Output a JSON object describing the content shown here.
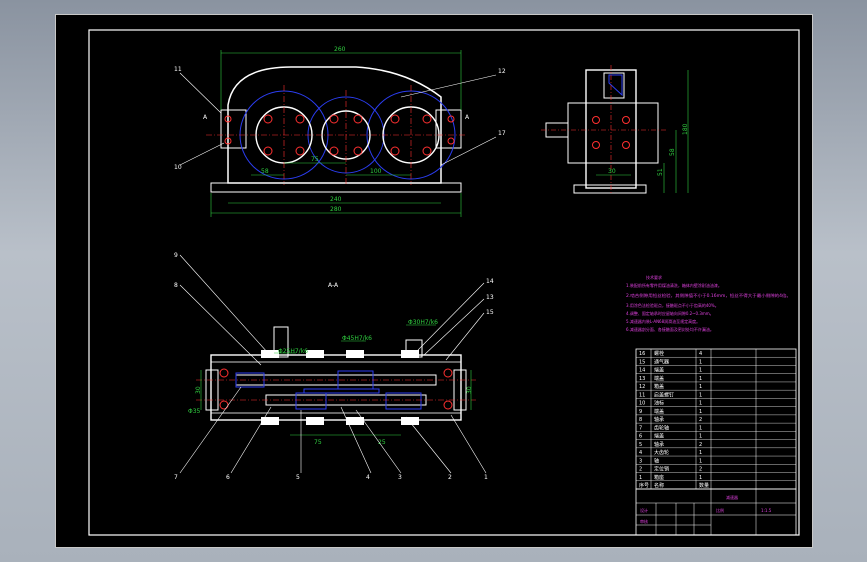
{
  "drawing": {
    "view_title": "A-A",
    "section_marks": [
      "A",
      "A"
    ],
    "front_dims": {
      "overall_top": "260",
      "overall_bottom_1": "240",
      "overall_bottom_2": "280",
      "center_1": "58",
      "center_2": "75",
      "center_3": "100"
    },
    "side_dims": {
      "d1": "58",
      "d2": "51",
      "d3": "180",
      "d4": "30"
    },
    "section_dims": {
      "bore_1": "Φ25H7/k6",
      "bore_2": "Φ45H7/k6",
      "bore_3": "Φ30H7/k6",
      "len_1": "75",
      "len_2": "25",
      "h_left": "30",
      "h_right": "30",
      "d_left": "Φ35"
    },
    "callouts_front": [
      "11",
      "10",
      "12",
      "17"
    ],
    "callouts_section": [
      "9",
      "8",
      "7",
      "6",
      "5",
      "4",
      "3",
      "2",
      "1",
      "14",
      "13",
      "15"
    ]
  },
  "tech_req": {
    "title": "技术要求",
    "lines": [
      "1.装配前所有零件用煤油清洗，箱体内壁涂耐油油漆。",
      "2.啮合侧隙用铅丝检验，其侧隙值不小于0.16mm，铅丝不得大于最小侧隙的4倍。",
      "3.用涂色法检验斑点，接触斑点不小于齿高的40%。",
      "4.调整、固定轴承时应留轴向间隙0.2~0.3mm。",
      "5.减速器内装L-AN68润滑油至规定高度。",
      "6.减速器剖分面、各接触面及密封处均不许漏油。"
    ]
  },
  "parts_table": {
    "rows": [
      [
        "16",
        "螺栓",
        "4"
      ],
      [
        "15",
        "通气器",
        "1"
      ],
      [
        "14",
        "端盖",
        "1"
      ],
      [
        "13",
        "端盖",
        "1"
      ],
      [
        "12",
        "箱盖",
        "1"
      ],
      [
        "11",
        "启盖螺钉",
        "1"
      ],
      [
        "10",
        "油标",
        "1"
      ],
      [
        "9",
        "端盖",
        "1"
      ],
      [
        "8",
        "轴承",
        "2"
      ],
      [
        "7",
        "齿轮轴",
        "1"
      ],
      [
        "6",
        "端盖",
        "1"
      ],
      [
        "5",
        "轴承",
        "2"
      ],
      [
        "4",
        "大齿轮",
        "1"
      ],
      [
        "3",
        "轴",
        "1"
      ],
      [
        "2",
        "定位销",
        "2"
      ],
      [
        "1",
        "箱座",
        "1"
      ]
    ],
    "header": [
      "序号",
      "名称",
      "数量"
    ]
  },
  "title_block": {
    "drawing_name": "减速器",
    "scale_label": "比例",
    "sheet_label": "1:1.5",
    "designer_label": "设计",
    "checker_label": "审核"
  },
  "colors": {
    "background": "#000000",
    "line": "#ffffff",
    "center": "#ff3030",
    "gear_circle": "#2b3df0",
    "dimension": "#30d040",
    "note": "#e040e0"
  }
}
